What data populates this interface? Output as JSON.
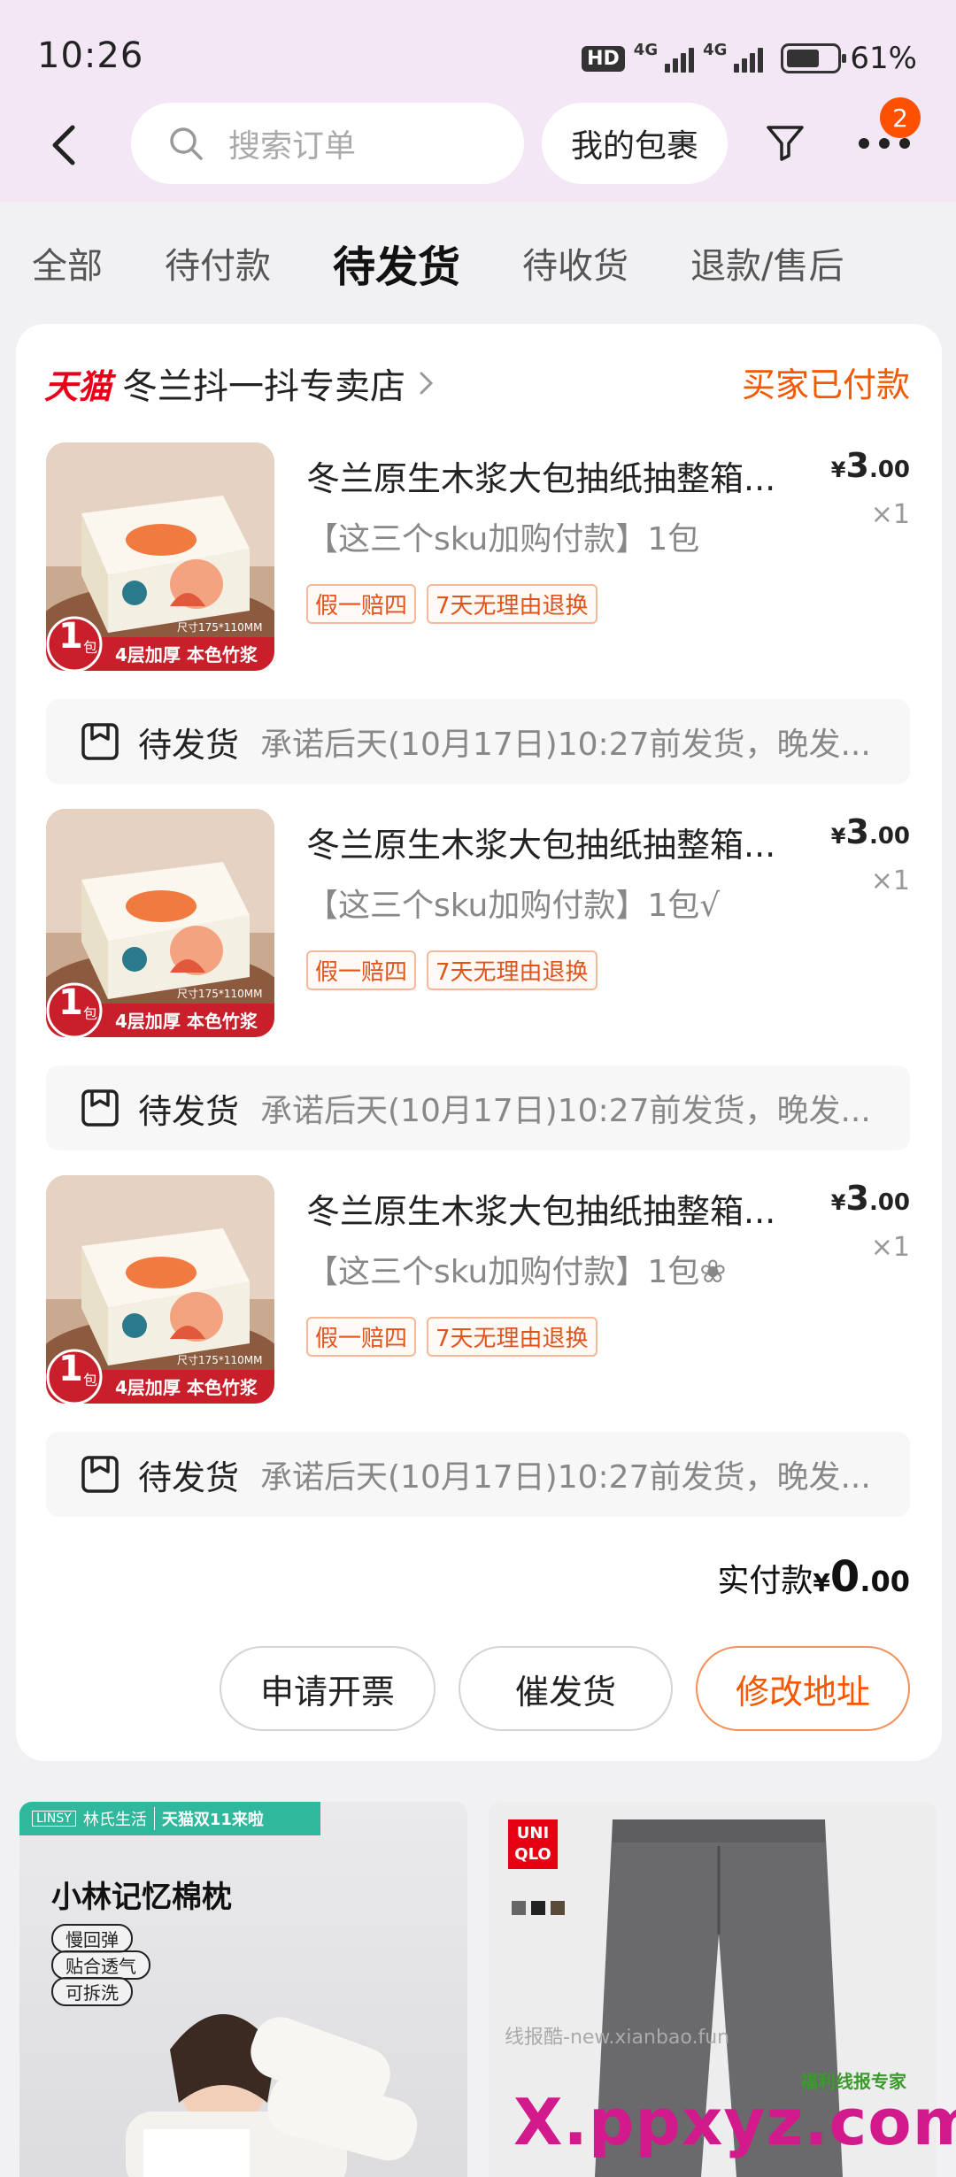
{
  "status_bar": {
    "time": "10:26",
    "hd": "HD",
    "net1": "4G",
    "net2": "4G",
    "battery": "61%"
  },
  "header": {
    "search_placeholder": "搜索订单",
    "packages_label": "我的包裹",
    "badge_count": "2"
  },
  "tabs": [
    {
      "label": "全部",
      "active": false
    },
    {
      "label": "待付款",
      "active": false
    },
    {
      "label": "待发货",
      "active": true
    },
    {
      "label": "待收货",
      "active": false
    },
    {
      "label": "退款/售后",
      "active": false
    }
  ],
  "order": {
    "platform": "天猫",
    "shop_name": "冬兰抖一抖专卖店",
    "status": "买家已付款",
    "items": [
      {
        "title": "冬兰原生木浆大包抽纸抽整箱...",
        "sku": "【这三个sku加购付款】1包",
        "tags": [
          "假一赔四",
          "7天无理由退换"
        ],
        "price_currency": "¥",
        "price_int": "3",
        "price_dec": ".00",
        "qty": "×1",
        "thumb_badge": "1",
        "thumb_unit": "包",
        "thumb_caption": "4层加厚 本色竹浆",
        "thumb_size": "尺寸175*110MM",
        "ship_label": "待发货",
        "ship_desc": "承诺后天(10月17日)10:27前发货，晚发..."
      },
      {
        "title": "冬兰原生木浆大包抽纸抽整箱...",
        "sku": "【这三个sku加购付款】1包√",
        "tags": [
          "假一赔四",
          "7天无理由退换"
        ],
        "price_currency": "¥",
        "price_int": "3",
        "price_dec": ".00",
        "qty": "×1",
        "thumb_badge": "1",
        "thumb_unit": "包",
        "thumb_caption": "4层加厚 本色竹浆",
        "thumb_size": "尺寸175*110MM",
        "ship_label": "待发货",
        "ship_desc": "承诺后天(10月17日)10:27前发货，晚发..."
      },
      {
        "title": "冬兰原生木浆大包抽纸抽整箱...",
        "sku": "【这三个sku加购付款】1包❀",
        "tags": [
          "假一赔四",
          "7天无理由退换"
        ],
        "price_currency": "¥",
        "price_int": "3",
        "price_dec": ".00",
        "qty": "×1",
        "thumb_badge": "1",
        "thumb_unit": "包",
        "thumb_caption": "4层加厚 本色竹浆",
        "thumb_size": "尺寸175*110MM",
        "ship_label": "待发货",
        "ship_desc": "承诺后天(10月17日)10:27前发货，晚发..."
      }
    ],
    "total_label": "实付款",
    "total_currency": "¥",
    "total_int": "0",
    "total_dec": ".00",
    "buttons": {
      "invoice": "申请开票",
      "urge": "催发货",
      "address": "修改地址"
    }
  },
  "recommendations": {
    "left": {
      "brand_logo": "LINSY",
      "brand": "林氏生活",
      "promo": "天猫双11来啦",
      "title": "小林记忆棉枕",
      "features": [
        "慢回弹",
        "贴合透气",
        "可拆洗"
      ]
    },
    "right": {
      "brand": "UNI QLO"
    }
  },
  "watermark": {
    "small": "线报酷-new.xianbao.fun",
    "badge": "福利线报专家",
    "big": "X.ppxyz.com"
  },
  "colors": {
    "accent": "#f55800",
    "tmall": "#e8001a",
    "header_bg": "#f3e7f6",
    "badge": "#ff5000"
  }
}
